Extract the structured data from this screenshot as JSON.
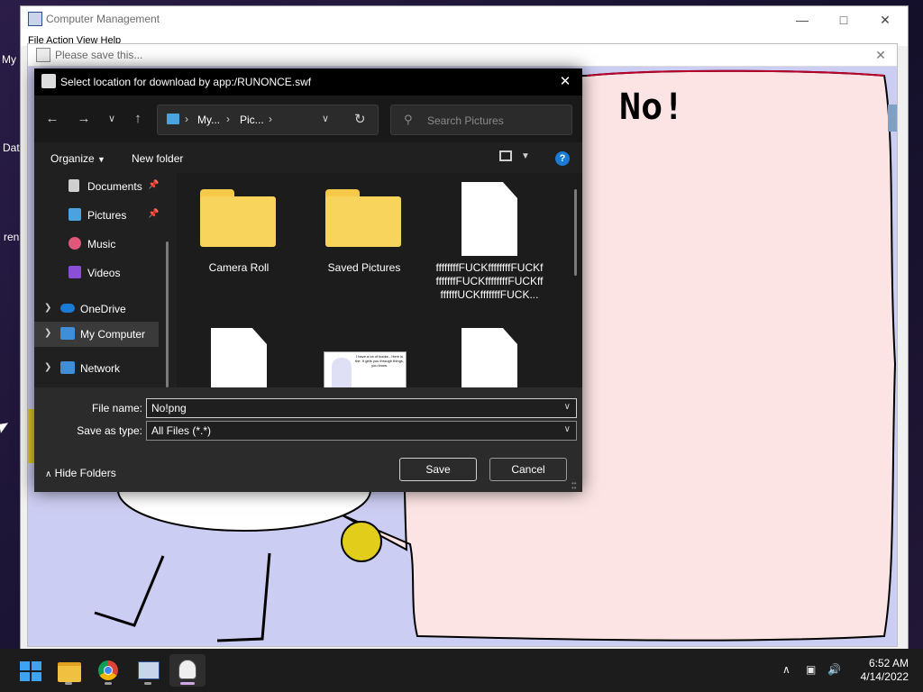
{
  "desktop": {
    "labels": [
      "My",
      "Dat",
      "ren"
    ]
  },
  "computer_management": {
    "title": "Computer Management",
    "menu": "File  Action  View  Help"
  },
  "flash_popup": {
    "title": "Please save this...",
    "speech_text": "No!",
    "thumb_text": "I have a lot of books - Here is the. It gets you through things, you know."
  },
  "dialog": {
    "title": "Select location for download by app:/RUNONCE.swf",
    "breadcrumb": [
      "My...",
      "Pic..."
    ],
    "search_placeholder": "Search Pictures",
    "toolbar": {
      "organize_label": "Organize",
      "new_folder_label": "New folder",
      "help": "?"
    },
    "sidebar": [
      {
        "label": "Documents",
        "icon": "documents-icon"
      },
      {
        "label": "Pictures",
        "icon": "pictures-icon"
      },
      {
        "label": "Music",
        "icon": "music-icon"
      },
      {
        "label": "Videos",
        "icon": "videos-icon"
      },
      {
        "label": "OneDrive",
        "icon": "onedrive-icon"
      },
      {
        "label": "My Computer",
        "icon": "computer-icon"
      },
      {
        "label": "Network",
        "icon": "network-icon"
      }
    ],
    "files": [
      {
        "name": "Camera Roll",
        "type": "folder"
      },
      {
        "name": "Saved Pictures",
        "type": "folder"
      },
      {
        "name": "ffffffffFUCKffffffffFUCKffffffffFUCKffffffffFUCKffffffffUCKfffffffFUCK...",
        "type": "file"
      },
      {
        "name": "",
        "type": "file"
      },
      {
        "name": "",
        "type": "image"
      },
      {
        "name": "",
        "type": "file"
      }
    ],
    "file_name_label": "File name:",
    "file_name_value": "No!png",
    "save_type_label": "Save as type:",
    "save_type_value": "All Files (*.*)",
    "hide_folders_label": "Hide Folders",
    "save_label": "Save",
    "cancel_label": "Cancel"
  },
  "taskbar": {
    "time": "6:52 AM",
    "date": "4/14/2022"
  },
  "colors": {
    "accent": "#1b7bd4",
    "folder": "#f8d45c",
    "speech_bubble": "#fde4e4",
    "flash_bg": "#cccdf2"
  }
}
